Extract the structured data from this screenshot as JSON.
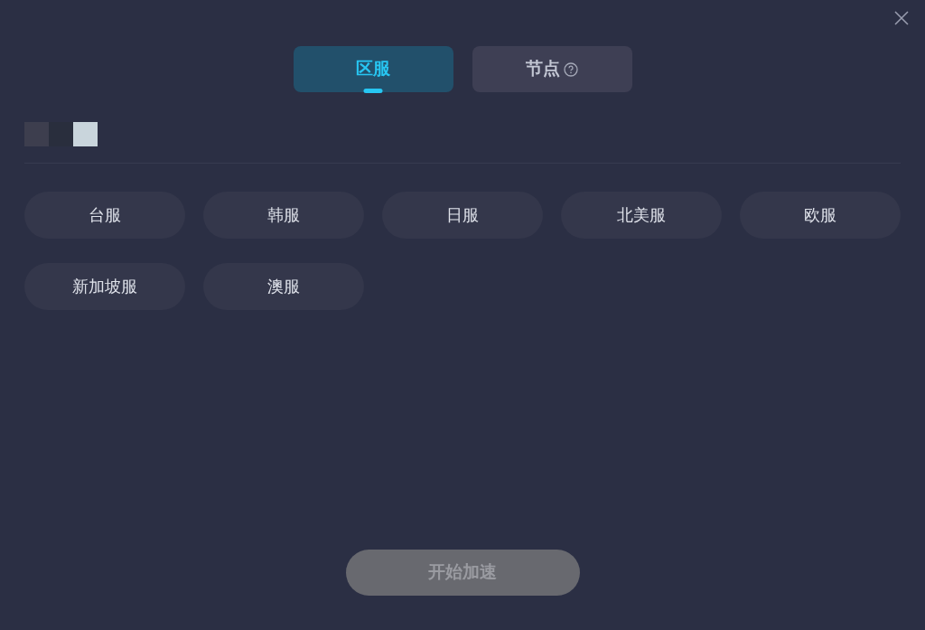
{
  "tabs": [
    {
      "label": "区服",
      "selected": true,
      "help": false
    },
    {
      "label": "节点",
      "selected": false,
      "help": true
    }
  ],
  "regions": [
    {
      "label": "台服",
      "selected": false
    },
    {
      "label": "韩服",
      "selected": false
    },
    {
      "label": "日服",
      "selected": false
    },
    {
      "label": "北美服",
      "selected": false
    },
    {
      "label": "欧服",
      "selected": false
    },
    {
      "label": "新加坡服",
      "selected": false
    },
    {
      "label": "澳服",
      "selected": false
    }
  ],
  "start_button": {
    "label": "开始加速",
    "disabled": true
  }
}
